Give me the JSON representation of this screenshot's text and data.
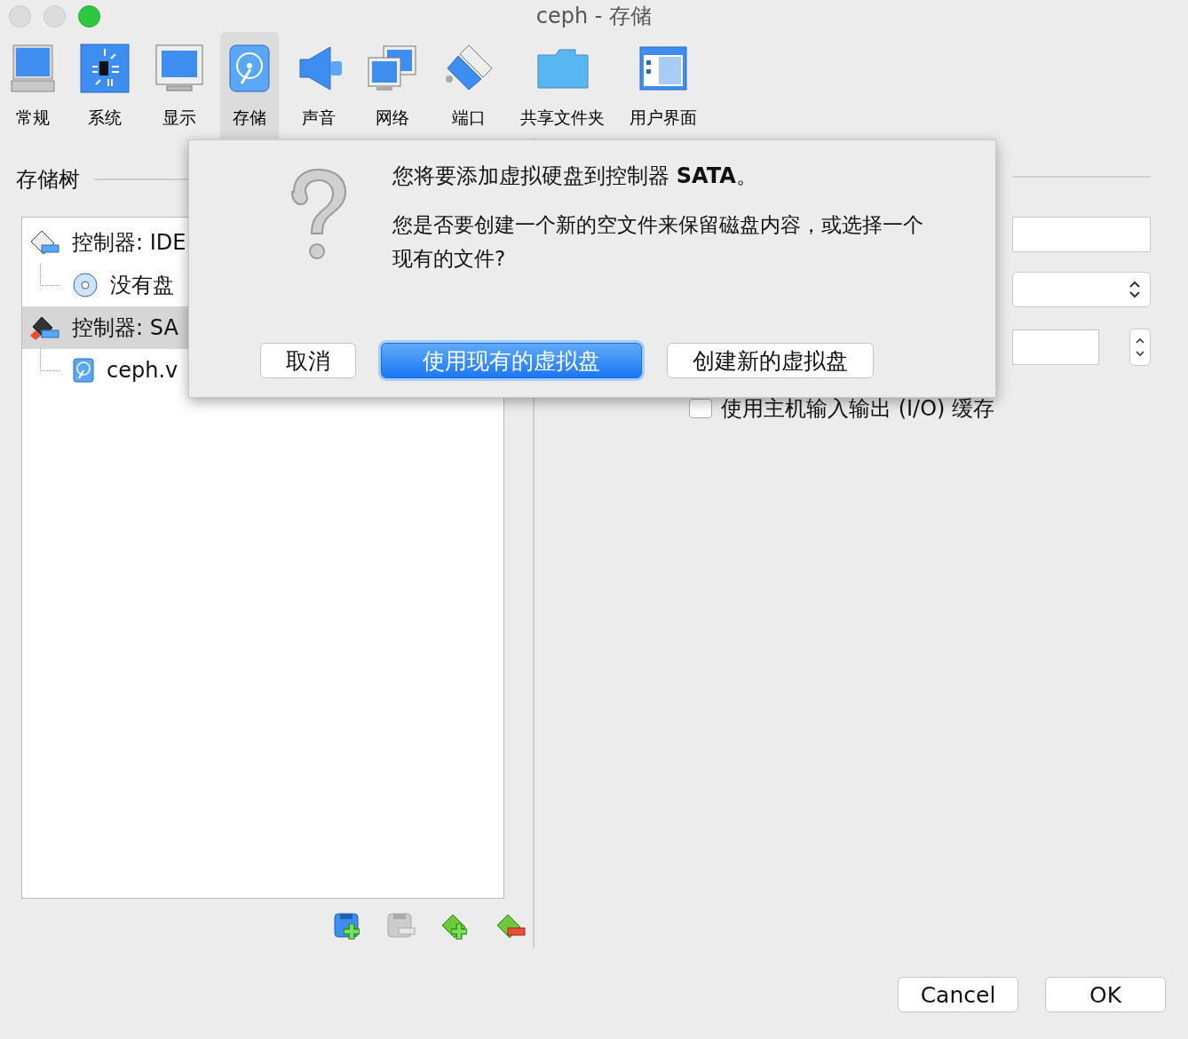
{
  "window": {
    "title": "ceph - 存储"
  },
  "toolbar": [
    {
      "label": "常规",
      "selected": false
    },
    {
      "label": "系统",
      "selected": false
    },
    {
      "label": "显示",
      "selected": false
    },
    {
      "label": "存储",
      "selected": true
    },
    {
      "label": "声音",
      "selected": false
    },
    {
      "label": "网络",
      "selected": false
    },
    {
      "label": "端口",
      "selected": false
    },
    {
      "label": "共享文件夹",
      "selected": false
    },
    {
      "label": "用户界面",
      "selected": false
    }
  ],
  "storage_tree": {
    "title": "存储树",
    "items": [
      {
        "kind": "ide",
        "label": "控制器: IDE",
        "selected": false,
        "children": [
          {
            "kind": "optical",
            "label": "没有盘",
            "selected": false
          }
        ]
      },
      {
        "kind": "sata",
        "label": "控制器: SA",
        "selected": true,
        "children": [
          {
            "kind": "disk",
            "label": "ceph.v",
            "selected": false
          }
        ]
      }
    ]
  },
  "attributes": {
    "checkbox": {
      "label": "使用主机输入输出 (I/O) 缓存",
      "checked": false
    }
  },
  "dialog": {
    "message": "您将要添加虚拟硬盘到控制器 **SATA**。",
    "detail": "您是否要创建一个新的空文件来保留磁盘内容，或选择一个现有的文件?",
    "buttons": [
      {
        "label": "取消",
        "default": false
      },
      {
        "label": "使用现有的虚拟盘",
        "default": true
      },
      {
        "label": "创建新的虚拟盘",
        "default": false
      }
    ]
  },
  "footer_buttons": [
    "Cancel",
    "OK"
  ]
}
